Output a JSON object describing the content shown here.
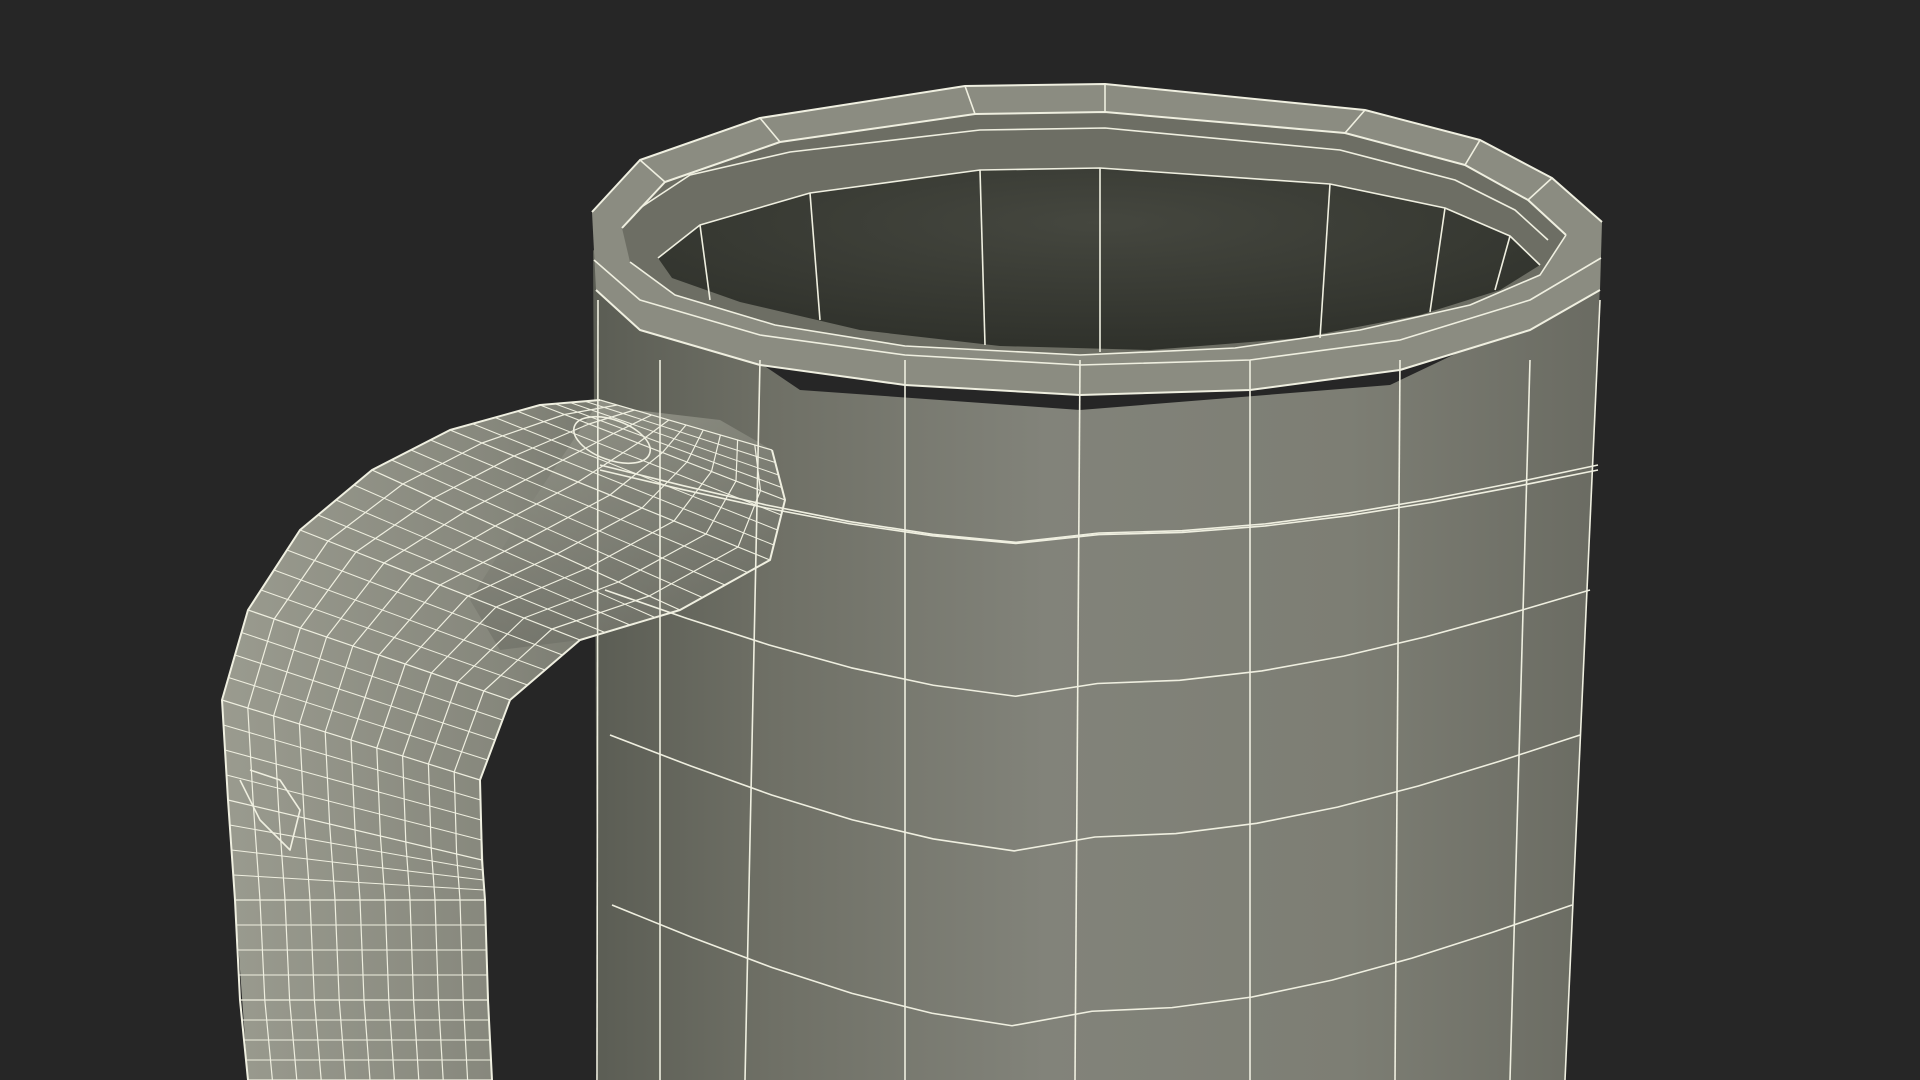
{
  "scene": {
    "subject": "mug-wireframe-render",
    "colors": {
      "background": "#262626",
      "surface_light": "#8a8a7e",
      "surface_mid": "#7c7d72",
      "surface_dark": "#5c5e55",
      "interior": "#3d3f37",
      "wire": "#efefe0"
    }
  }
}
